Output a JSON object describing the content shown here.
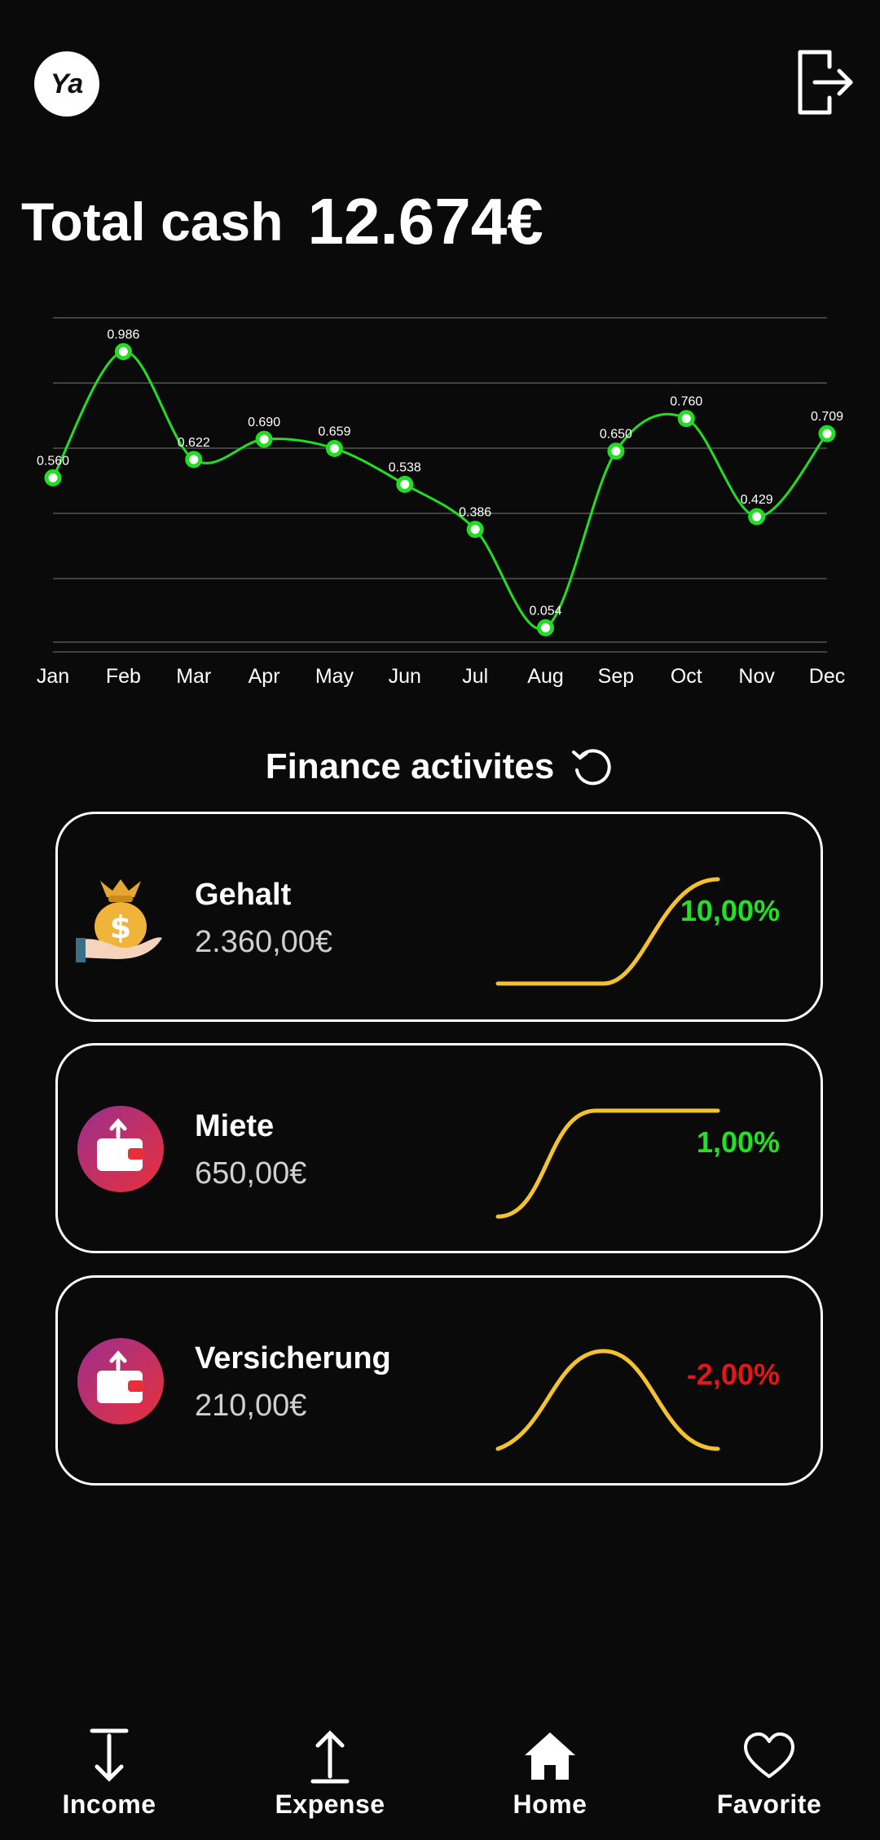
{
  "header": {
    "avatar_initials": "Ya",
    "logout_icon": "logout-icon"
  },
  "total": {
    "label": "Total cash",
    "value": "12.674€"
  },
  "chart_data": {
    "type": "line",
    "categories": [
      "Jan",
      "Feb",
      "Mar",
      "Apr",
      "May",
      "Jun",
      "Jul",
      "Aug",
      "Sep",
      "Oct",
      "Nov",
      "Dec"
    ],
    "values": [
      0.56,
      0.986,
      0.622,
      0.69,
      0.659,
      0.538,
      0.386,
      0.054,
      0.65,
      0.76,
      0.429,
      0.709
    ],
    "value_labels": [
      "0.560",
      "0.986",
      "0.622",
      "0.690",
      "0.659",
      "0.538",
      "0.386",
      "0.054",
      "0.650",
      "0.760",
      "0.429",
      "0.709"
    ],
    "ylim": [
      0,
      1.1
    ],
    "grid": true,
    "line_color": "#22dd22"
  },
  "section": {
    "title": "Finance activites",
    "refresh_icon": "refresh-icon"
  },
  "activities": [
    {
      "name": "Gehalt",
      "amount": "2.360,00€",
      "percent": "10,00%",
      "percent_color": "#22e022",
      "icon": "money-bag-hand-icon",
      "trend": "up"
    },
    {
      "name": "Miete",
      "amount": "650,00€",
      "percent": "1,00%",
      "percent_color": "#22e022",
      "icon": "wallet-icon",
      "trend": "up-plateau"
    },
    {
      "name": "Versicherung",
      "amount": "210,00€",
      "percent": "-2,00%",
      "percent_color": "#e01818",
      "icon": "wallet-icon",
      "trend": "peak"
    }
  ],
  "nav": {
    "income": "Income",
    "expense": "Expense",
    "home": "Home",
    "favorite": "Favorite"
  },
  "colors": {
    "spark": "#f2c230",
    "accent": "#22e022",
    "negative": "#e01818"
  }
}
